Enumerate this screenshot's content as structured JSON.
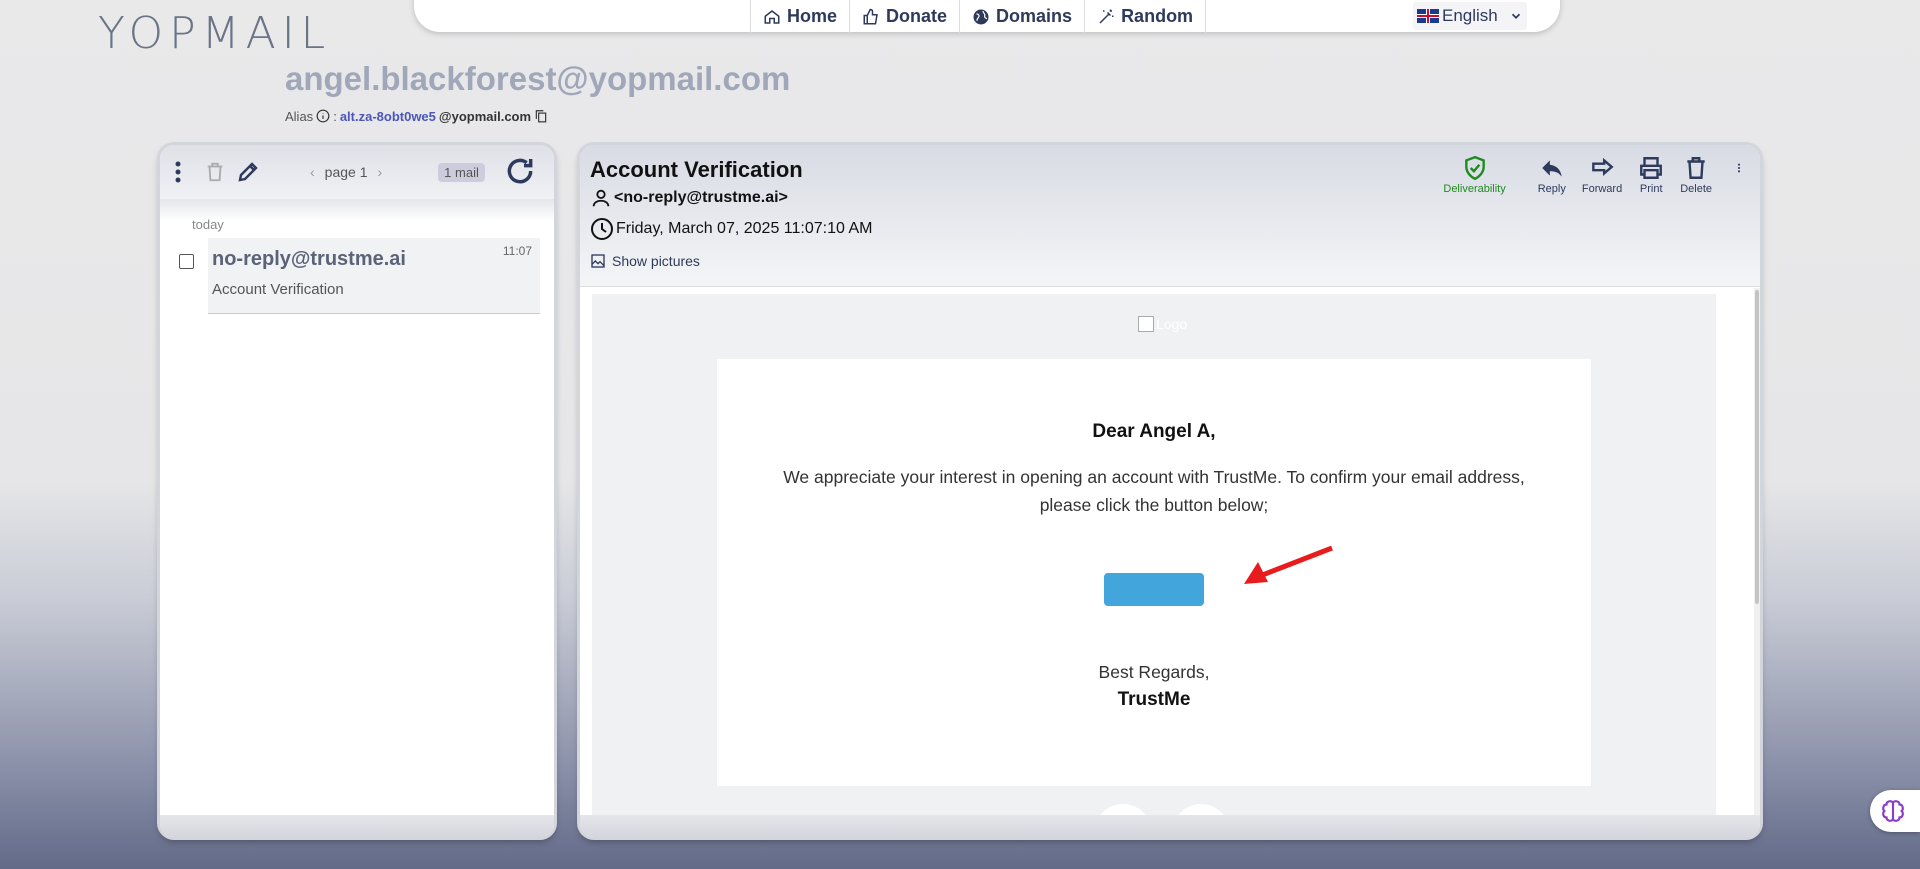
{
  "logo": {
    "text": "YOPMAIL"
  },
  "nav": {
    "items": [
      {
        "label": "Home",
        "icon": "home-icon"
      },
      {
        "label": "Donate",
        "icon": "thumbs-up-icon"
      },
      {
        "label": "Domains",
        "icon": "globe-icon"
      },
      {
        "label": "Random",
        "icon": "magic-wand-icon"
      }
    ],
    "language": "English"
  },
  "inbox": {
    "address": "angel.blackforest@yopmail.com",
    "alias_label": "Alias",
    "alias_value": "alt.za-8obt0we5",
    "alias_domain": "@yopmail.com"
  },
  "list": {
    "page_label": "page 1",
    "mail_count": "1 mail",
    "day": "today",
    "mails": [
      {
        "from": "no-reply@trustme.ai",
        "subject": "Account Verification",
        "time": "11:07"
      }
    ]
  },
  "message": {
    "subject": "Account Verification",
    "from": "<no-reply@trustme.ai>",
    "date": "Friday, March 07, 2025 11:07:10 AM",
    "show_pictures": "Show pictures",
    "actions": {
      "deliverability": "Deliverability",
      "reply": "Reply",
      "forward": "Forward",
      "print": "Print",
      "delete": "Delete"
    },
    "body": {
      "logo_alt": "Logo",
      "greeting": "Dear Angel A,",
      "paragraph": "We appreciate your interest in opening an account with TrustMe. To confirm your email address, please click the button below;",
      "regards": "Best Regards,",
      "signature": "TrustMe"
    }
  },
  "colors": {
    "accent": "#2e3a5c",
    "button": "#42a5dc",
    "deliverability": "#1f8a1f",
    "arrow": "#e81c1c"
  }
}
